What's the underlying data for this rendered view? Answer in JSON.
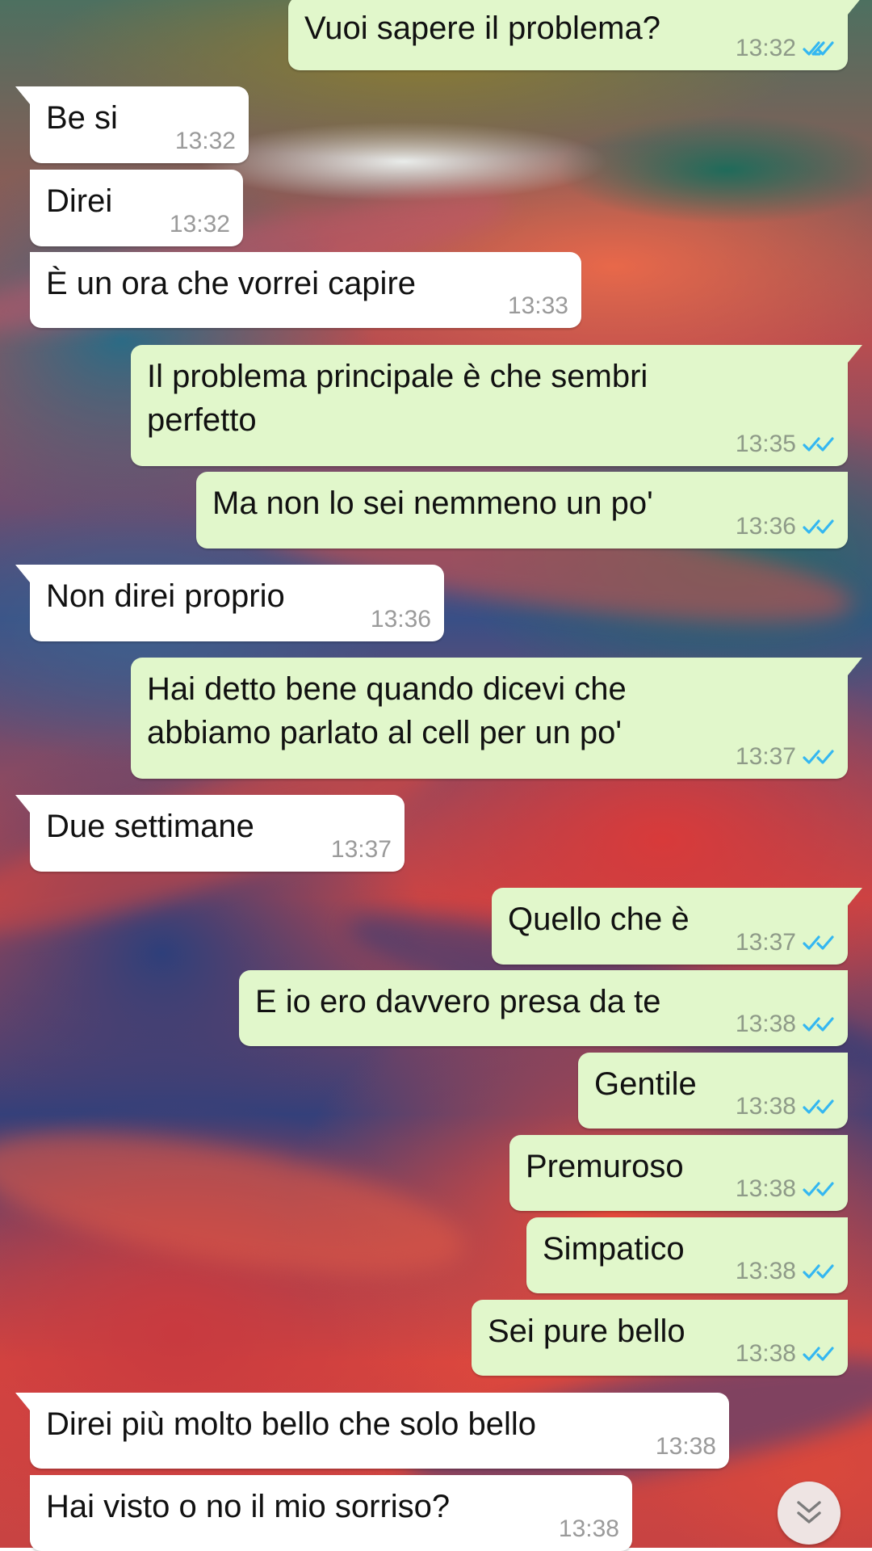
{
  "chat": {
    "messages": [
      {
        "direction": "out",
        "text": "Vuoi sapere il problema?",
        "time": "13:32",
        "status": "read"
      },
      {
        "direction": "in",
        "text": "Be si",
        "time": "13:32"
      },
      {
        "direction": "in",
        "text": "Direi",
        "time": "13:32"
      },
      {
        "direction": "in",
        "text": "È un ora che vorrei capire",
        "time": "13:33"
      },
      {
        "direction": "out",
        "text": "Il problema principale è che sembri\nperfetto",
        "time": "13:35",
        "status": "read"
      },
      {
        "direction": "out",
        "text": "Ma non lo sei nemmeno un po'",
        "time": "13:36",
        "status": "read"
      },
      {
        "direction": "in",
        "text": "Non direi proprio",
        "time": "13:36"
      },
      {
        "direction": "out",
        "text": "Hai detto bene quando dicevi che\nabbiamo parlato al cell per un po'",
        "time": "13:37",
        "status": "read"
      },
      {
        "direction": "in",
        "text": "Due settimane",
        "time": "13:37"
      },
      {
        "direction": "out",
        "text": "Quello che è",
        "time": "13:37",
        "status": "read"
      },
      {
        "direction": "out",
        "text": "E io ero davvero presa da te",
        "time": "13:38",
        "status": "read"
      },
      {
        "direction": "out",
        "text": "Gentile",
        "time": "13:38",
        "status": "read"
      },
      {
        "direction": "out",
        "text": "Premuroso",
        "time": "13:38",
        "status": "read"
      },
      {
        "direction": "out",
        "text": "Simpatico",
        "time": "13:38",
        "status": "read"
      },
      {
        "direction": "out",
        "text": "Sei pure bello",
        "time": "13:38",
        "status": "read"
      },
      {
        "direction": "in",
        "text": "Direi più molto bello che solo bello",
        "time": "13:38"
      },
      {
        "direction": "in",
        "text": "Hai visto o no il mio sorriso?",
        "time": "13:38"
      }
    ]
  },
  "icons": {
    "read_receipt": "double-check-icon",
    "scroll_down": "chevron-double-down-icon"
  },
  "colors": {
    "incoming_bubble": "#ffffff",
    "outgoing_bubble": "#e1f7cb",
    "read_tick": "#34b7f1",
    "timestamp": "#9a9a9a"
  }
}
